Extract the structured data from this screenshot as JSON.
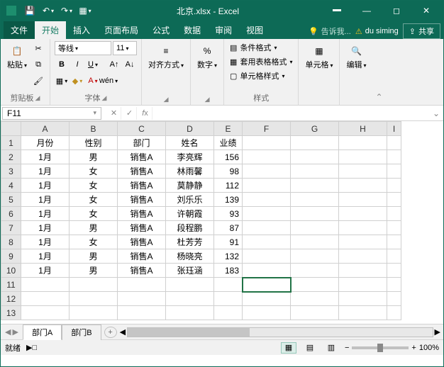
{
  "title": "北京.xlsx - Excel",
  "ribbon": {
    "file": "文件",
    "tabs": [
      "开始",
      "插入",
      "页面布局",
      "公式",
      "数据",
      "审阅",
      "视图"
    ],
    "active_tab": "开始",
    "tell_me": "告诉我...",
    "user": "du siming",
    "share": "共享"
  },
  "groups": {
    "clipboard": {
      "label": "剪贴板",
      "paste": "粘贴"
    },
    "font": {
      "label": "字体",
      "family": "等线",
      "size": "11",
      "pinyin": "wén"
    },
    "align": {
      "label": "对齐方式"
    },
    "number": {
      "label": "数字"
    },
    "styles": {
      "label": "样式",
      "cond": "条件格式",
      "tablefmt": "套用表格格式",
      "cellstyle": "单元格样式"
    },
    "cells": {
      "label": "单元格"
    },
    "editing": {
      "label": "编辑"
    }
  },
  "namebox": "F11",
  "columns": [
    "A",
    "B",
    "C",
    "D",
    "E",
    "F",
    "G",
    "H",
    "I"
  ],
  "header_row": [
    "月份",
    "性别",
    "部门",
    "姓名",
    "业绩"
  ],
  "data_rows": [
    [
      "1月",
      "男",
      "销售A",
      "李亮辉",
      "156"
    ],
    [
      "1月",
      "女",
      "销售A",
      "林雨馨",
      "98"
    ],
    [
      "1月",
      "女",
      "销售A",
      "莫静静",
      "112"
    ],
    [
      "1月",
      "女",
      "销售A",
      "刘乐乐",
      "139"
    ],
    [
      "1月",
      "女",
      "销售A",
      "许朝霞",
      "93"
    ],
    [
      "1月",
      "男",
      "销售A",
      "段程鹏",
      "87"
    ],
    [
      "1月",
      "女",
      "销售A",
      "杜芳芳",
      "91"
    ],
    [
      "1月",
      "男",
      "销售A",
      "杨晓亮",
      "132"
    ],
    [
      "1月",
      "男",
      "销售A",
      "张珏涵",
      "183"
    ]
  ],
  "empty_rows": 3,
  "sheets": {
    "active": "部门A",
    "tabs": [
      "部门A",
      "部门B"
    ]
  },
  "status": {
    "ready": "就绪",
    "zoom": "100%"
  },
  "chart_data": {
    "type": "table",
    "columns": [
      "月份",
      "性别",
      "部门",
      "姓名",
      "业绩"
    ],
    "rows": [
      {
        "月份": "1月",
        "性别": "男",
        "部门": "销售A",
        "姓名": "李亮辉",
        "业绩": 156
      },
      {
        "月份": "1月",
        "性别": "女",
        "部门": "销售A",
        "姓名": "林雨馨",
        "业绩": 98
      },
      {
        "月份": "1月",
        "性别": "女",
        "部门": "销售A",
        "姓名": "莫静静",
        "业绩": 112
      },
      {
        "月份": "1月",
        "性别": "女",
        "部门": "销售A",
        "姓名": "刘乐乐",
        "业绩": 139
      },
      {
        "月份": "1月",
        "性别": "女",
        "部门": "销售A",
        "姓名": "许朝霞",
        "业绩": 93
      },
      {
        "月份": "1月",
        "性别": "男",
        "部门": "销售A",
        "姓名": "段程鹏",
        "业绩": 87
      },
      {
        "月份": "1月",
        "性别": "女",
        "部门": "销售A",
        "姓名": "杜芳芳",
        "业绩": 91
      },
      {
        "月份": "1月",
        "性别": "男",
        "部门": "销售A",
        "姓名": "杨晓亮",
        "业绩": 132
      },
      {
        "月份": "1月",
        "性别": "男",
        "部门": "销售A",
        "姓名": "张珏涵",
        "业绩": 183
      }
    ]
  }
}
